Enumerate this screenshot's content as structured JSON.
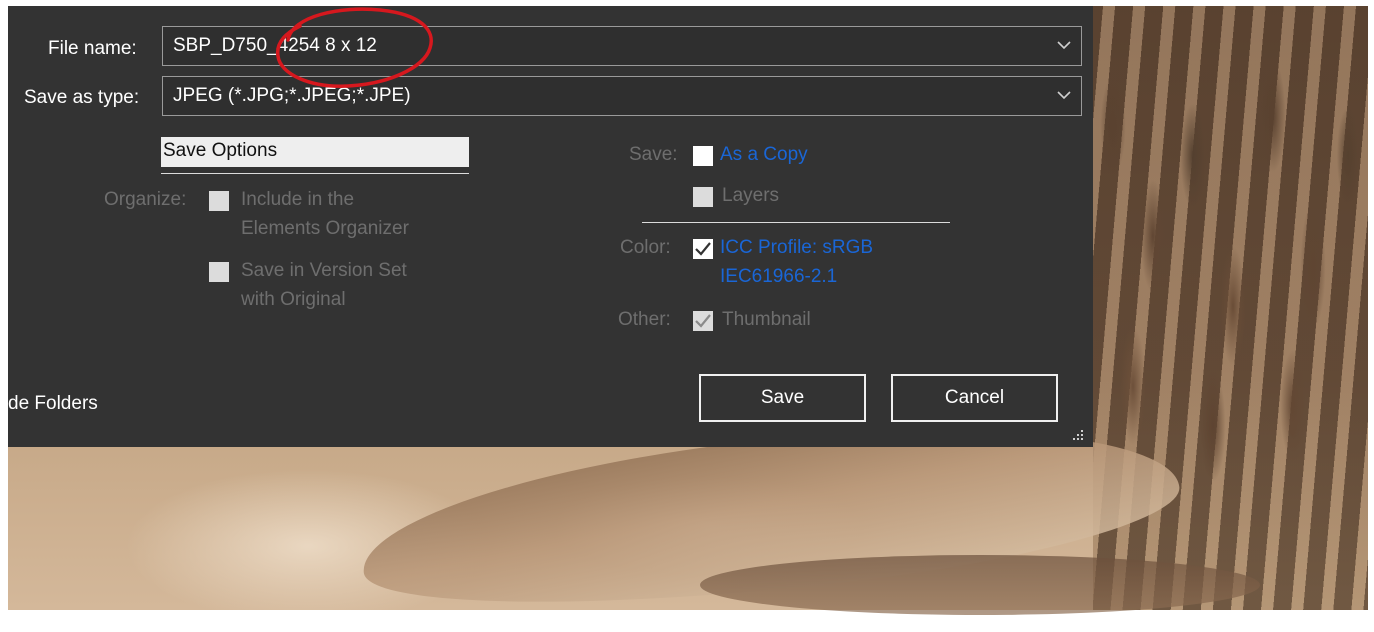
{
  "dialog": {
    "file_name_label": "File name:",
    "file_name_value": "SBP_D750_4254 8 x 12",
    "save_as_type_label": "Save as type:",
    "save_as_type_value": "JPEG (*.JPG;*.JPEG;*.JPE)",
    "save_options_button": "Save Options",
    "organize_label": "Organize:",
    "include_organizer_line1": "Include in the",
    "include_organizer_line2": "Elements Organizer",
    "version_set_line1": "Save in Version Set",
    "version_set_line2": "with Original",
    "save_label": "Save:",
    "as_a_copy": "As a Copy",
    "layers": "Layers",
    "color_label": "Color:",
    "icc_line1": "ICC Profile:  sRGB",
    "icc_line2": "IEC61966-2.1",
    "other_label": "Other:",
    "thumbnail": "Thumbnail",
    "hide_folders": "de Folders",
    "save_button": "Save",
    "cancel_button": "Cancel",
    "checkboxes": {
      "include_organizer": false,
      "version_set": false,
      "as_a_copy": false,
      "layers": false,
      "icc_profile": true,
      "thumbnail": true
    }
  },
  "annotation": {
    "circle_color": "#d6181e"
  },
  "colors": {
    "dialog_bg": "#333333",
    "link_blue": "#1a66d6",
    "disabled_text": "#6e6e6e"
  }
}
